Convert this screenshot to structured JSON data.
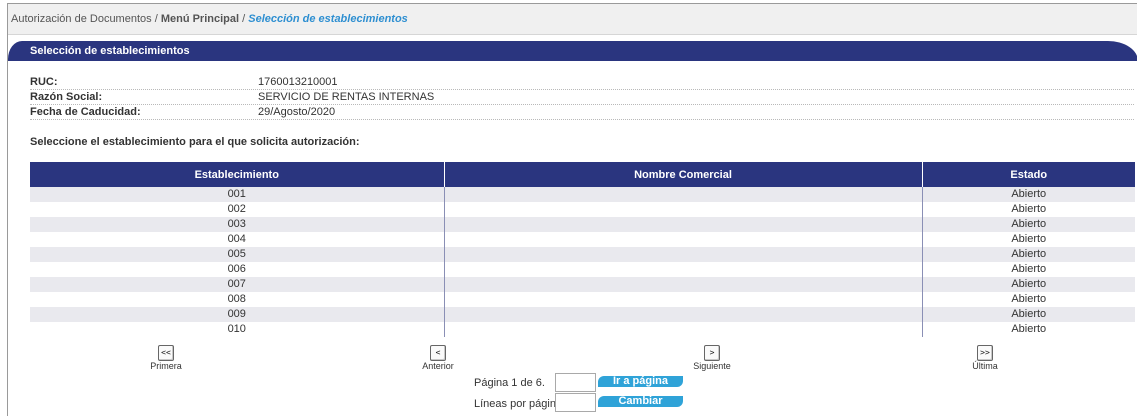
{
  "breadcrumb": {
    "part1": "Autorización de Documentos",
    "sep1": " / ",
    "part2": "Menú Principal",
    "sep2": " / ",
    "current": "Selección de establecimientos"
  },
  "section_title": "Selección de establecimientos",
  "info": {
    "ruc_label": "RUC:",
    "ruc_value": "1760013210001",
    "razon_label": "Razón Social:",
    "razon_value": "SERVICIO DE RENTAS INTERNAS",
    "fecha_label": "Fecha de Caducidad:",
    "fecha_value": "29/Agosto/2020"
  },
  "instruction": "Seleccione el establecimiento para el que solicita autorización:",
  "table": {
    "headers": [
      "Establecimiento",
      "Nombre Comercial",
      "Estado"
    ],
    "rows": [
      [
        "001",
        "",
        "Abierto"
      ],
      [
        "002",
        "",
        "Abierto"
      ],
      [
        "003",
        "",
        "Abierto"
      ],
      [
        "004",
        "",
        "Abierto"
      ],
      [
        "005",
        "",
        "Abierto"
      ],
      [
        "006",
        "",
        "Abierto"
      ],
      [
        "007",
        "",
        "Abierto"
      ],
      [
        "008",
        "",
        "Abierto"
      ],
      [
        "009",
        "",
        "Abierto"
      ],
      [
        "010",
        "",
        "Abierto"
      ]
    ]
  },
  "pager": {
    "first_symbol": "<<",
    "first_label": "Primera",
    "prev_symbol": "<",
    "prev_label": "Anterior",
    "next_symbol": ">",
    "next_label": "Siguiente",
    "last_symbol": ">>",
    "last_label": "Última",
    "page_info": "Página 1 de 6.",
    "goto_button": "Ir a página",
    "lines_label": "Líneas por página:",
    "change_button": "Cambiar"
  }
}
